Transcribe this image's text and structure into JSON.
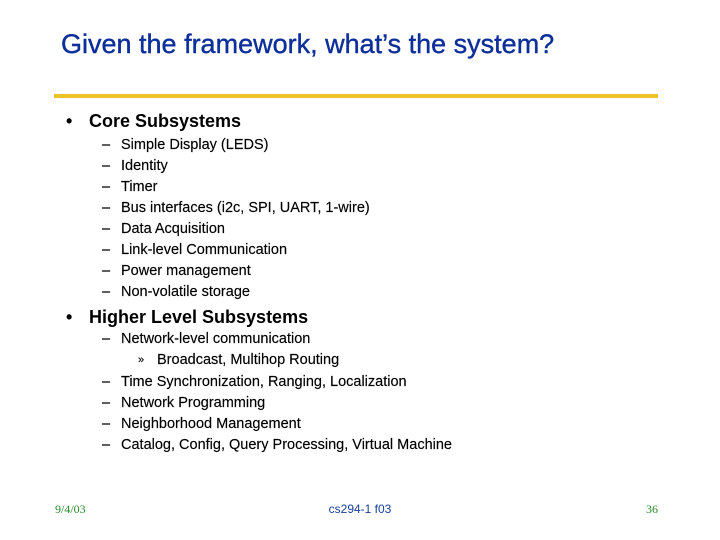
{
  "slide": {
    "title": "Given the framework, what’s the system?",
    "colors": {
      "title": "#0d2f9a",
      "rule": "#f0c22a",
      "body_text": "#000000",
      "footer_side": "#2a8a2a",
      "footer_center": "#1a3f9a"
    },
    "sections": [
      {
        "bullet": "•",
        "heading": "Core Subsystems",
        "items": [
          {
            "marker": "–",
            "text": "Simple Display (LEDS)"
          },
          {
            "marker": "–",
            "text": "Identity"
          },
          {
            "marker": "–",
            "text": "Timer"
          },
          {
            "marker": "–",
            "text": "Bus interfaces (i2c, SPI, UART, 1-wire)"
          },
          {
            "marker": "–",
            "text": "Data Acquisition"
          },
          {
            "marker": "–",
            "text": "Link-level Communication"
          },
          {
            "marker": "–",
            "text": "Power management"
          },
          {
            "marker": "–",
            "text": "Non-volatile storage"
          }
        ]
      },
      {
        "bullet": "•",
        "heading": "Higher Level Subsystems",
        "items": [
          {
            "marker": "–",
            "text": "Network-level communication",
            "subitems": [
              {
                "marker": "»",
                "text": "Broadcast, Multihop Routing"
              }
            ]
          },
          {
            "marker": "–",
            "text": "Time Synchronization, Ranging, Localization"
          },
          {
            "marker": "–",
            "text": "Network Programming"
          },
          {
            "marker": "–",
            "text": "Neighborhood Management"
          },
          {
            "marker": "–",
            "text": "Catalog, Config, Query Processing, Virtual Machine"
          }
        ]
      }
    ]
  },
  "footer": {
    "date": "9/4/03",
    "course": "cs294-1 f03",
    "page_number": "36"
  }
}
